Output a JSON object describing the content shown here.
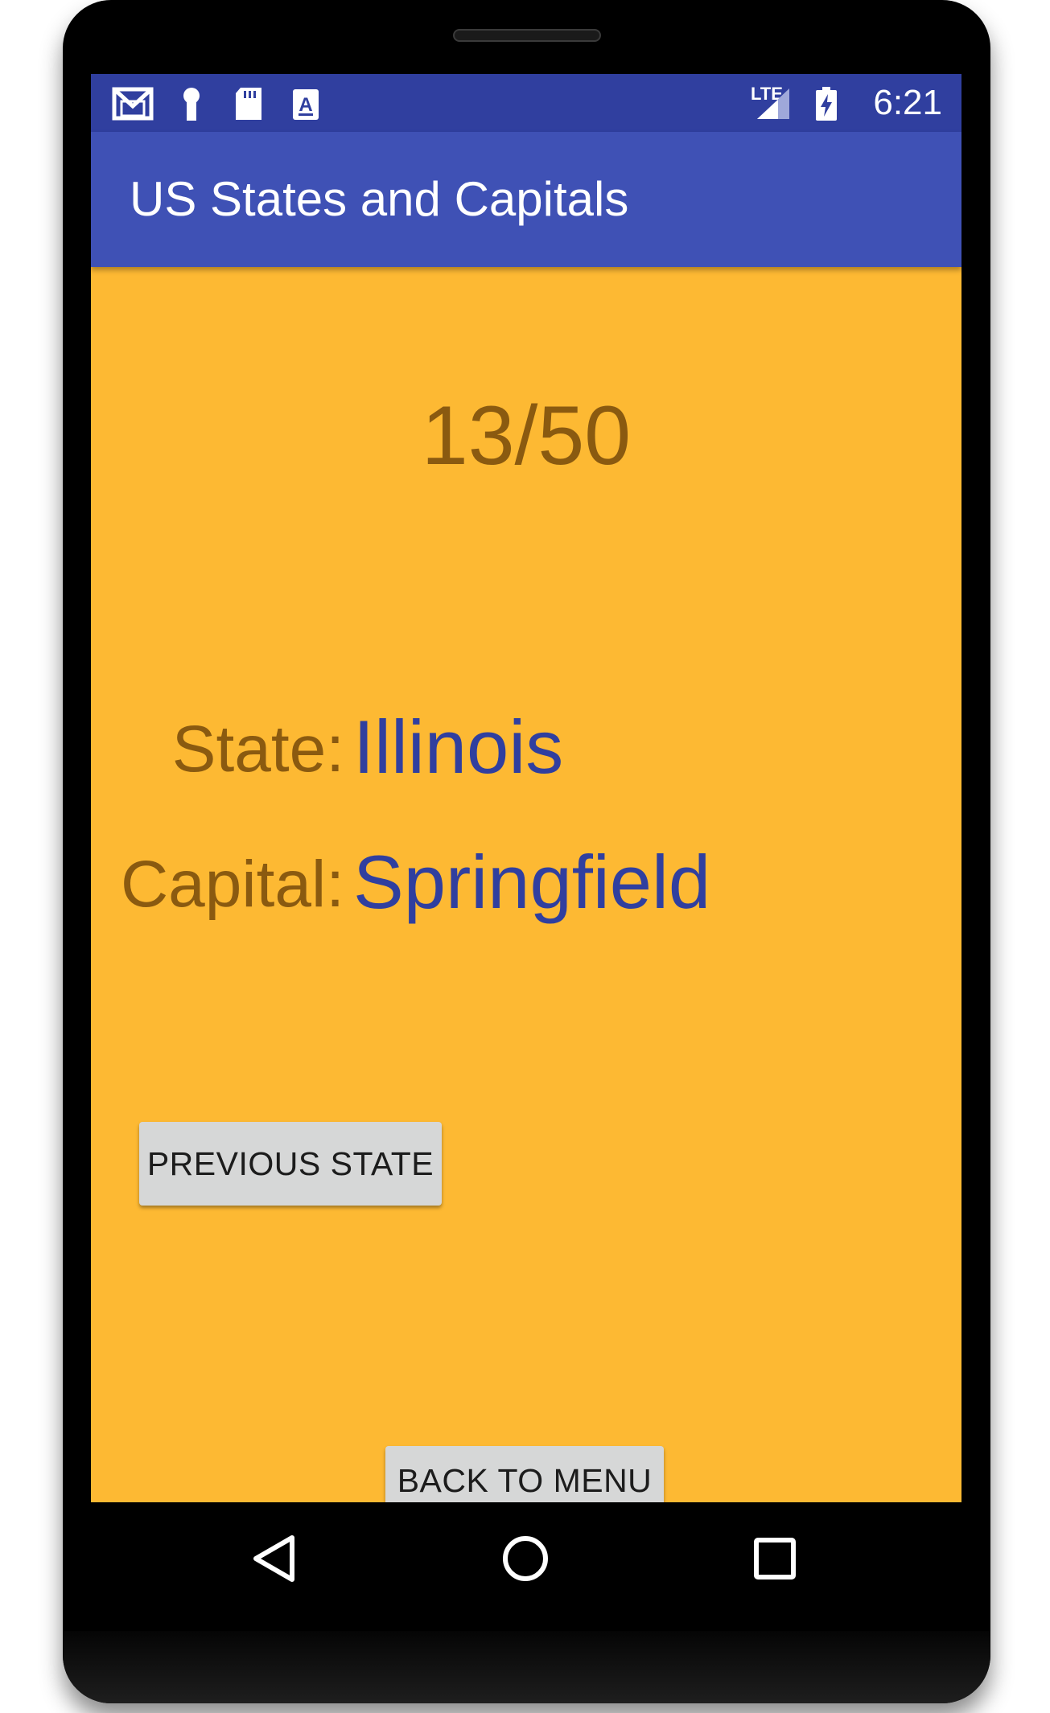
{
  "status_bar": {
    "icons": [
      "gmail-icon",
      "keyhole-icon",
      "sd-card-icon",
      "keyboard-a-icon"
    ],
    "network_label": "LTE",
    "time": "6:21"
  },
  "app_bar": {
    "title": "US States and Capitals"
  },
  "main": {
    "progress": "13/50",
    "state_label": "State:",
    "state_value": "Illinois",
    "capital_label": "Capital:",
    "capital_value": "Springfield",
    "previous_button": "PREVIOUS STATE",
    "back_button": "BACK TO MENU"
  },
  "nav_bar": {
    "icons": [
      "back-icon",
      "home-icon",
      "recents-icon"
    ]
  },
  "colors": {
    "status_bar": "#303f9f",
    "app_bar": "#3f51b5",
    "background": "#fdb933",
    "label_text": "#8a5a10",
    "value_text": "#303f9f",
    "button_bg": "#d6d7d7"
  }
}
